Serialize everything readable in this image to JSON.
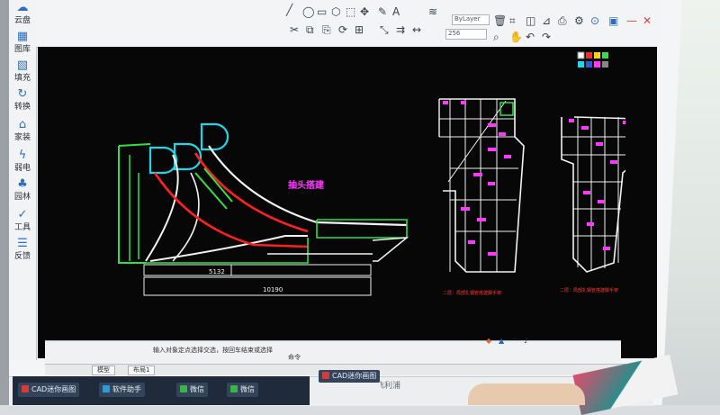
{
  "left_toolbar": {
    "items": [
      {
        "label": "云盘",
        "icon": "cloud-icon"
      },
      {
        "label": "图库",
        "icon": "library-icon"
      },
      {
        "label": "填充",
        "icon": "fill-icon"
      },
      {
        "label": "转换",
        "icon": "convert-icon"
      },
      {
        "label": "家装",
        "icon": "home-decor-icon"
      },
      {
        "label": "弱电",
        "icon": "low-voltage-icon"
      },
      {
        "label": "园林",
        "icon": "garden-icon"
      },
      {
        "label": "工具",
        "icon": "tools-icon"
      },
      {
        "label": "反馈",
        "icon": "feedback-icon"
      }
    ]
  },
  "ribbon": {
    "layer_value": "ByLayer",
    "lineweight_value": "256"
  },
  "drawing": {
    "title_annotation": "抽头搭建",
    "dims": {
      "width_5132": "5132",
      "width_10190": "10190"
    },
    "note_left": "二层：局部扎钢管搭建脚手架",
    "note_right": "二层：局部扎钢管搭建脚手架"
  },
  "layout_tabs": [
    "模型",
    "布局1"
  ],
  "command_line": {
    "text": "输入对象定点选择交选，按回车结束或选择",
    "status": "命令"
  },
  "taskbar": {
    "apps": [
      {
        "label": "CAD迷你画图",
        "color": "#d43b3b"
      },
      {
        "label": "软件助手",
        "color": "#2d9bd6"
      },
      {
        "label": "微信",
        "color": "#3ab54a"
      },
      {
        "label": "微信",
        "color": "#3ab54a"
      },
      {
        "label": "CAD迷你画图",
        "color": "#d43b3b"
      }
    ]
  },
  "monitor_brand": "飞利浦"
}
